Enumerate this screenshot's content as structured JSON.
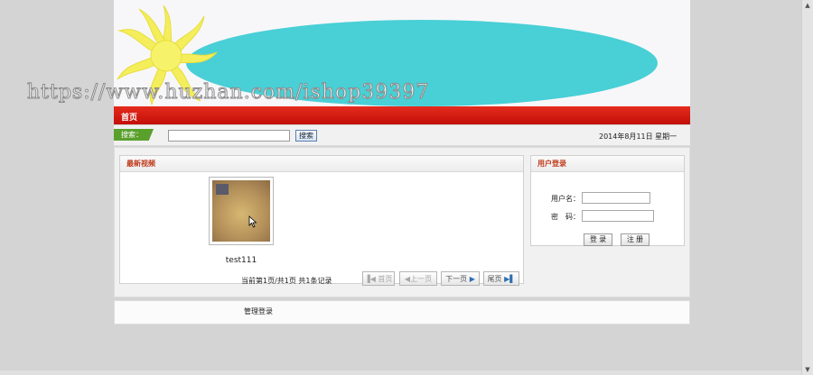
{
  "watermark": "https://www.huzhan.com/ishop39397",
  "nav": {
    "home": "首页"
  },
  "search": {
    "tag": "搜索：",
    "value": "",
    "button": "搜索"
  },
  "date": "2014年8月11日 星期一",
  "videos": {
    "title": "最新视频",
    "items": [
      {
        "name": "test111"
      }
    ],
    "pager": {
      "info": "当前第1页/共1页  共1条记录",
      "first": "首页",
      "prev": "上一页",
      "next": "下一页",
      "last": "尾页"
    }
  },
  "login": {
    "title": "用户登录",
    "username_label": "用户名：",
    "password_label": "密　码：",
    "login_button": "登 录",
    "register_button": "注 册"
  },
  "footer": {
    "admin_link": "管理登录"
  },
  "colors": {
    "nav_red": "#d91a10",
    "banner_cyan": "#49cfd6",
    "sun_yellow": "#f4ee5c",
    "search_green": "#5aa02c"
  }
}
